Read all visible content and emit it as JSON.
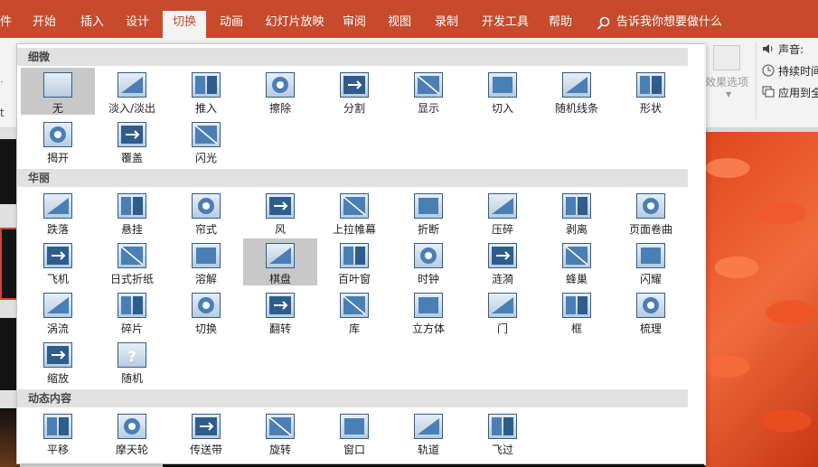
{
  "ribbon_tabs": [
    {
      "label": "件"
    },
    {
      "label": "开始"
    },
    {
      "label": "插入"
    },
    {
      "label": "设计"
    },
    {
      "label": "切换"
    },
    {
      "label": "动画"
    },
    {
      "label": "幻灯片放映"
    },
    {
      "label": "审阅"
    },
    {
      "label": "视图"
    },
    {
      "label": "录制"
    },
    {
      "label": "开发工具"
    },
    {
      "label": "帮助"
    }
  ],
  "active_tab": "切换",
  "tell_me": {
    "label": "告诉我你想要做什么",
    "icon": "lightbulb-search-icon"
  },
  "ribbon": {
    "effect_options_label": "效果选项",
    "sound_label": "声音:",
    "duration_label": "持续时间",
    "apply_all_label": "应用到全"
  },
  "left_edge": {
    "a": "·",
    "b": "t"
  },
  "accent_color": "#c74a2c",
  "gallery": {
    "sections": [
      {
        "title": "细微",
        "items": [
          {
            "label": "无",
            "icon": "none-transition-icon",
            "selected": true
          },
          {
            "label": "淡入/淡出",
            "icon": "fade-transition-icon"
          },
          {
            "label": "推入",
            "icon": "push-transition-icon"
          },
          {
            "label": "擦除",
            "icon": "wipe-transition-icon"
          },
          {
            "label": "分割",
            "icon": "split-transition-icon"
          },
          {
            "label": "显示",
            "icon": "reveal-transition-icon"
          },
          {
            "label": "切入",
            "icon": "cut-transition-icon"
          },
          {
            "label": "随机线条",
            "icon": "random-bars-transition-icon"
          },
          {
            "label": "形状",
            "icon": "shape-transition-icon"
          },
          {
            "label": "揭开",
            "icon": "uncover-transition-icon"
          },
          {
            "label": "覆盖",
            "icon": "cover-transition-icon"
          },
          {
            "label": "闪光",
            "icon": "flash-transition-icon"
          }
        ]
      },
      {
        "title": "华丽",
        "items": [
          {
            "label": "跌落",
            "icon": "fall-over-transition-icon"
          },
          {
            "label": "悬挂",
            "icon": "drape-transition-icon"
          },
          {
            "label": "帘式",
            "icon": "curtains-transition-icon"
          },
          {
            "label": "风",
            "icon": "wind-transition-icon"
          },
          {
            "label": "上拉帷幕",
            "icon": "prestige-transition-icon"
          },
          {
            "label": "折断",
            "icon": "fracture-transition-icon"
          },
          {
            "label": "压碎",
            "icon": "crush-transition-icon"
          },
          {
            "label": "剥离",
            "icon": "peel-off-transition-icon"
          },
          {
            "label": "页面卷曲",
            "icon": "page-curl-transition-icon"
          },
          {
            "label": "飞机",
            "icon": "airplane-transition-icon"
          },
          {
            "label": "日式折纸",
            "icon": "origami-transition-icon"
          },
          {
            "label": "溶解",
            "icon": "dissolve-transition-icon"
          },
          {
            "label": "棋盘",
            "icon": "checkerboard-transition-icon",
            "hovered": true
          },
          {
            "label": "百叶窗",
            "icon": "blinds-transition-icon"
          },
          {
            "label": "时钟",
            "icon": "clock-transition-icon"
          },
          {
            "label": "涟漪",
            "icon": "ripple-transition-icon"
          },
          {
            "label": "蜂巢",
            "icon": "honeycomb-transition-icon"
          },
          {
            "label": "闪耀",
            "icon": "glitter-transition-icon"
          },
          {
            "label": "涡流",
            "icon": "vortex-transition-icon"
          },
          {
            "label": "碎片",
            "icon": "shred-transition-icon"
          },
          {
            "label": "切换",
            "icon": "switch-transition-icon"
          },
          {
            "label": "翻转",
            "icon": "flip-transition-icon"
          },
          {
            "label": "库",
            "icon": "gallery-transition-icon"
          },
          {
            "label": "立方体",
            "icon": "cube-transition-icon"
          },
          {
            "label": "门",
            "icon": "doors-transition-icon"
          },
          {
            "label": "框",
            "icon": "box-transition-icon"
          },
          {
            "label": "梳理",
            "icon": "comb-transition-icon"
          },
          {
            "label": "缩放",
            "icon": "zoom-transition-icon"
          },
          {
            "label": "随机",
            "icon": "random-transition-icon"
          }
        ]
      },
      {
        "title": "动态内容",
        "items": [
          {
            "label": "平移",
            "icon": "pan-transition-icon"
          },
          {
            "label": "摩天轮",
            "icon": "ferris-wheel-transition-icon"
          },
          {
            "label": "传送带",
            "icon": "conveyor-transition-icon"
          },
          {
            "label": "旋转",
            "icon": "rotate-transition-icon"
          },
          {
            "label": "窗口",
            "icon": "window-transition-icon"
          },
          {
            "label": "轨道",
            "icon": "orbit-transition-icon"
          },
          {
            "label": "飞过",
            "icon": "fly-through-transition-icon"
          }
        ]
      }
    ]
  }
}
